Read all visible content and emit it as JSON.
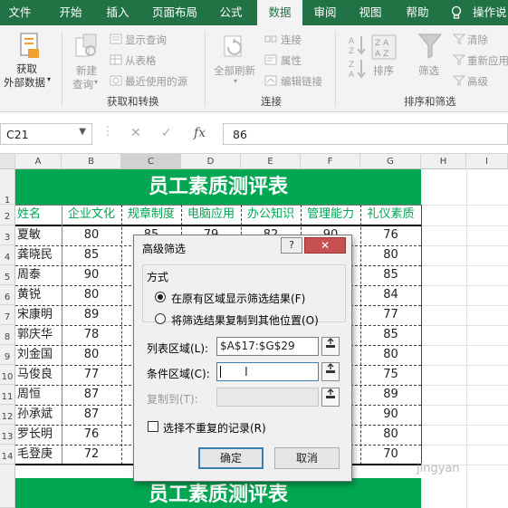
{
  "ribbon_tabs": [
    "文件",
    "开始",
    "插入",
    "页面布局",
    "公式",
    "数据",
    "审阅",
    "视图",
    "帮助"
  ],
  "active_tab": "数据",
  "tell_me": "操作说",
  "ribbon": {
    "get_external_data": "获取\n外部数据",
    "get_external_data_l1": "获取",
    "get_external_data_l2": "外部数据",
    "new_query_l1": "新建",
    "new_query_l2": "查询",
    "show_queries": "显示查询",
    "from_table": "从表格",
    "recent_sources": "最近使用的源",
    "group_get_transform": "获取和转换",
    "refresh_all": "全部刷新",
    "connections": "连接",
    "properties": "属性",
    "edit_links": "编辑链接",
    "group_connections": "连接",
    "sort": "排序",
    "filter": "筛选",
    "clear": "清除",
    "reapply": "重新应用",
    "advanced": "高级",
    "group_sort_filter": "排序和筛选",
    "sort_az": "A↓Z",
    "sort_za": "Z↓A"
  },
  "formula_bar": {
    "name_box": "C21",
    "fx": "fx",
    "value": "86"
  },
  "columns": [
    "A",
    "B",
    "C",
    "D",
    "E",
    "F",
    "G",
    "H",
    "I"
  ],
  "rows": [
    "1",
    "2",
    "3",
    "4",
    "5",
    "6",
    "7",
    "8",
    "9",
    "10",
    "11",
    "12",
    "13",
    "14"
  ],
  "sheet": {
    "title": "员工素质测评表",
    "headers": [
      "姓名",
      "企业文化",
      "规章制度",
      "电脑应用",
      "办公知识",
      "管理能力",
      "礼仪素质"
    ],
    "names": [
      "夏敏",
      "龚晓民",
      "周泰",
      "黄锐",
      "宋康明",
      "郭庆华",
      "刘金国",
      "马俊良",
      "周恒",
      "孙承斌",
      "罗长明",
      "毛登庚"
    ],
    "col_b": [
      "80",
      "85",
      "90",
      "80",
      "89",
      "78",
      "80",
      "77",
      "87",
      "87",
      "76",
      "72"
    ],
    "col_g": [
      "76",
      "80",
      "85",
      "84",
      "77",
      "85",
      "80",
      "75",
      "89",
      "90",
      "80",
      "70"
    ],
    "partial_c": "85",
    "partial_d": "79",
    "partial_e": "82",
    "partial_f": "90",
    "title_repeat": "员工素质测评表"
  },
  "dialog": {
    "title": "高级筛选",
    "help": "?",
    "close": "✕",
    "method_label": "方式",
    "option1": "在原有区域显示筛选结果(F)",
    "option2": "将筛选结果复制到其他位置(O)",
    "list_range_label": "列表区域(L):",
    "list_range_value": "$A$17:$G$29",
    "criteria_label": "条件区域(C):",
    "criteria_value": "",
    "copy_to_label": "复制到(T):",
    "unique_label": "选择不重复的记录(R)",
    "ok": "确定",
    "cancel": "取消",
    "selected_option": 1
  },
  "watermark": "jingyan",
  "colors": {
    "excel_green": "#217346",
    "title_green": "#00a651",
    "close_red": "#c75050"
  }
}
